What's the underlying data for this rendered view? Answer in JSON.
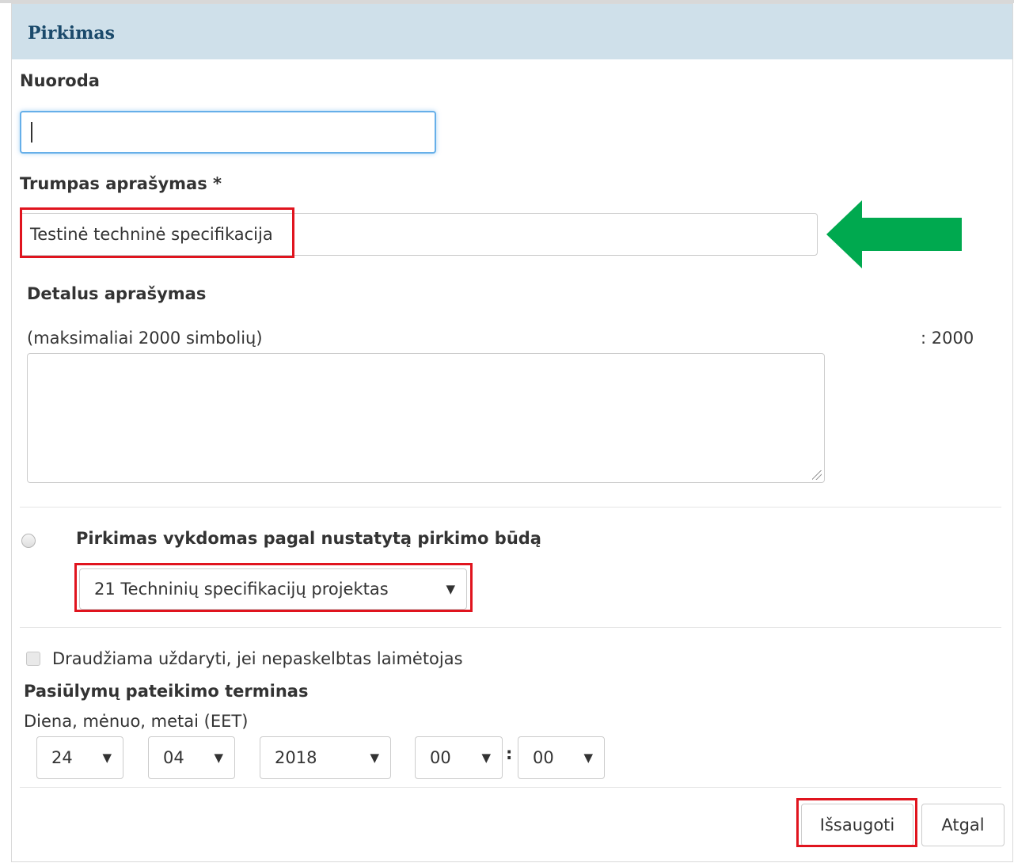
{
  "panel": {
    "title": "Pirkimas"
  },
  "nuoroda": {
    "label": "Nuoroda",
    "value": ""
  },
  "short_desc": {
    "label": "Trumpas aprašymas *",
    "value": "Testinė techninė specifikacija"
  },
  "detail_desc": {
    "label": "Detalus aprašymas",
    "hint": "(maksimaliai 2000 simbolių)",
    "counter": ": 2000",
    "value": ""
  },
  "procurement": {
    "radio_label": "Pirkimas vykdomas pagal nustatytą pirkimo būdą",
    "selected_method": "21 Techninių specifikacijų projektas"
  },
  "no_close": {
    "label": "Draudžiama uždaryti, jei nepaskelbtas laimėtojas"
  },
  "deadline": {
    "label": "Pasiūlymų pateikimo terminas",
    "format": "Diena, mėnuo, metai (EET)",
    "day": "24",
    "month": "04",
    "year": "2018",
    "hour": "00",
    "separator": ":",
    "minute": "00"
  },
  "actions": {
    "save": "Išsaugoti",
    "back": "Atgal"
  },
  "colors": {
    "header_bg": "#cfe0ea",
    "title": "#1b4a6b",
    "highlight": "#e0141e",
    "arrow": "#00a94f"
  },
  "icons": {
    "dropdown": "▼",
    "pointer": "arrow-left-icon"
  }
}
